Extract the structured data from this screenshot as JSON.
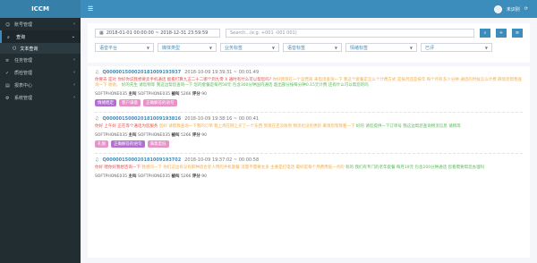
{
  "app": {
    "brand": "ICCM",
    "user": "未识别"
  },
  "sidebar": {
    "items": [
      {
        "label": "账号管理",
        "active": false
      },
      {
        "label": "查询",
        "active": true
      },
      {
        "label": "任务管理",
        "active": false
      },
      {
        "label": "质检管理",
        "active": false
      },
      {
        "label": "报表中心",
        "active": false
      },
      {
        "label": "系统管理",
        "active": false
      }
    ],
    "sub": {
      "label": "文本查询"
    }
  },
  "filters": {
    "date_range": "2018-01-01 00:00:00 ~ 2018-12-31 23:59:59",
    "search_placeholder": "Search...(e.g. +001 -001 001)",
    "selects": [
      {
        "label": "语音平台"
      },
      {
        "label": "媒体类型"
      },
      {
        "label": "业务标签"
      },
      {
        "label": "语音标签"
      },
      {
        "label": "情绪标签"
      },
      {
        "label": "已评"
      }
    ]
  },
  "records": [
    {
      "id": "Q000001500020181009193937",
      "time": "2018-10-09 19:39:31 ~ 00:01:49",
      "body_a": "你要去 是对 你好你说我想要卖手机通话 能看打算九五二十二哪个到九零 X 通时有什么可以帮您吗?",
      "body_b": "你好我现在一个运营商 来电话查询一下 我这个套餐是怎么个计费方式 是按月还是按年 每个月有多少分钟 通话的时候怎么计费 麻烦您帮我查询一下 谢谢。",
      "body_c": "好的先生 请您稍等 我这边帮您查询一下 您的套餐是每月58元 包含300分钟国内通话 超出部分按每分钟0.15元计费 还有什么可以帮您的吗",
      "agent": "SOFTPHONE035",
      "caller": "SOFTPHONE035",
      "ext": "5266",
      "score": "90",
      "tags": [
        "情绪稳定",
        "客户满意",
        "正确解答的语句"
      ]
    },
    {
      "id": "Q000001500020181009193816",
      "time": "2018-10-09 19:38:16 ~ 00:00:41",
      "body_a": "你好 上午好 正在等个通话为您服务",
      "body_b": "您好 请帮我查询一下我的订单 我上周在网上买了一个东西 到现在还没收到 物流也没有更新 麻烦您帮我看一下",
      "body_c": "好的 请您提供一下订单号 我这边帮您查询物流信息 请稍等",
      "agent": "SOFTPHONE035",
      "caller": "SOFTPHONE035",
      "ext": "5266",
      "score": "90",
      "tags": [
        "礼貌",
        "正确解答的语句",
        "满意度低"
      ]
    },
    {
      "id": "Q000001500020181009193702",
      "time": "2018-10-09 19:37:02 ~ 00:00:58",
      "body_a": "你好 喂你好我想咨询一下",
      "body_b": "我想问一下 你们这边有没有那种适合老人用的手机套餐 流量不需要太多 主要是打电话 最好是每个月费用低一点的",
      "body_c": "有的 我们有专门的老年套餐 每月19元 包含200分钟通话 您看需要帮您办理吗",
      "agent": "SOFTPHONE035",
      "caller": "SOFTPHONE035",
      "ext": "5266",
      "score": "90",
      "tags": []
    }
  ],
  "labels": {
    "agent": "主叫",
    "ext": "被叫",
    "score": "评分"
  },
  "colors": {
    "accent": "#3c8dbc",
    "sidebar": "#222d32",
    "topbar": "#3c8dbc"
  }
}
